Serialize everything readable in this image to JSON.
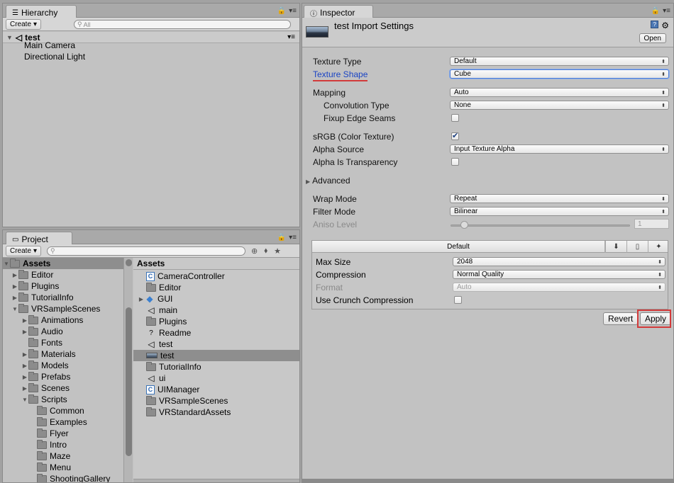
{
  "hierarchy": {
    "tab_label": "Hierarchy",
    "create_label": "Create",
    "search_placeholder": "All",
    "scene_name": "test",
    "items": [
      "Main Camera",
      "Directional Light"
    ]
  },
  "project": {
    "tab_label": "Project",
    "create_label": "Create",
    "tree": [
      {
        "label": "Assets",
        "depth": 0,
        "expanded": true,
        "selected": true
      },
      {
        "label": "Editor",
        "depth": 1,
        "collapsed": true
      },
      {
        "label": "Plugins",
        "depth": 1,
        "collapsed": true
      },
      {
        "label": "TutorialInfo",
        "depth": 1,
        "collapsed": true
      },
      {
        "label": "VRSampleScenes",
        "depth": 1,
        "expanded": true
      },
      {
        "label": "Animations",
        "depth": 2,
        "collapsed": true
      },
      {
        "label": "Audio",
        "depth": 2,
        "collapsed": true
      },
      {
        "label": "Fonts",
        "depth": 2
      },
      {
        "label": "Materials",
        "depth": 2,
        "collapsed": true
      },
      {
        "label": "Models",
        "depth": 2,
        "collapsed": true
      },
      {
        "label": "Prefabs",
        "depth": 2,
        "collapsed": true
      },
      {
        "label": "Scenes",
        "depth": 2,
        "collapsed": true
      },
      {
        "label": "Scripts",
        "depth": 2,
        "expanded": true
      },
      {
        "label": "Common",
        "depth": 3
      },
      {
        "label": "Examples",
        "depth": 3
      },
      {
        "label": "Flyer",
        "depth": 3
      },
      {
        "label": "Intro",
        "depth": 3
      },
      {
        "label": "Maze",
        "depth": 3
      },
      {
        "label": "Menu",
        "depth": 3
      },
      {
        "label": "ShootingGallery",
        "depth": 3
      }
    ],
    "assets_header": "Assets",
    "assets": [
      {
        "label": "CameraController",
        "icon": "script-icon"
      },
      {
        "label": "Editor",
        "icon": "folder-icon"
      },
      {
        "label": "GUI",
        "icon": "cube-icon",
        "collapsed": true
      },
      {
        "label": "main",
        "icon": "unity-scene-icon"
      },
      {
        "label": "Plugins",
        "icon": "folder-icon"
      },
      {
        "label": "Readme",
        "icon": "question-icon"
      },
      {
        "label": "test",
        "icon": "unity-scene-icon"
      },
      {
        "label": "test",
        "icon": "texture-icon",
        "selected": true
      },
      {
        "label": "TutorialInfo",
        "icon": "folder-icon"
      },
      {
        "label": "ui",
        "icon": "unity-scene-icon"
      },
      {
        "label": "UIManager",
        "icon": "script-icon"
      },
      {
        "label": "VRSampleScenes",
        "icon": "folder-icon"
      },
      {
        "label": "VRStandardAssets",
        "icon": "folder-icon"
      }
    ]
  },
  "inspector": {
    "tab_label": "Inspector",
    "title": "test Import Settings",
    "open_label": "Open",
    "texture_type": {
      "label": "Texture Type",
      "value": "Default"
    },
    "texture_shape": {
      "label": "Texture Shape",
      "value": "Cube"
    },
    "mapping": {
      "label": "Mapping",
      "value": "Auto"
    },
    "convolution_type": {
      "label": "Convolution Type",
      "value": "None"
    },
    "fixup_edge_seams": {
      "label": "Fixup Edge Seams",
      "checked": false
    },
    "srgb": {
      "label": "sRGB (Color Texture)",
      "checked": true
    },
    "alpha_source": {
      "label": "Alpha Source",
      "value": "Input Texture Alpha"
    },
    "alpha_is_transparency": {
      "label": "Alpha Is Transparency",
      "checked": false
    },
    "advanced_label": "Advanced",
    "wrap_mode": {
      "label": "Wrap Mode",
      "value": "Repeat"
    },
    "filter_mode": {
      "label": "Filter Mode",
      "value": "Bilinear"
    },
    "aniso_level": {
      "label": "Aniso Level",
      "value": "1"
    },
    "platform": {
      "title": "Default",
      "max_size": {
        "label": "Max Size",
        "value": "2048"
      },
      "compression": {
        "label": "Compression",
        "value": "Normal Quality"
      },
      "format": {
        "label": "Format",
        "value": "Auto"
      },
      "crunch": {
        "label": "Use Crunch Compression",
        "checked": false
      }
    },
    "revert_label": "Revert",
    "apply_label": "Apply"
  },
  "colors": {
    "highlight": "#d33a3a",
    "link": "#1a44c4",
    "selection": "#8e8e8e"
  }
}
